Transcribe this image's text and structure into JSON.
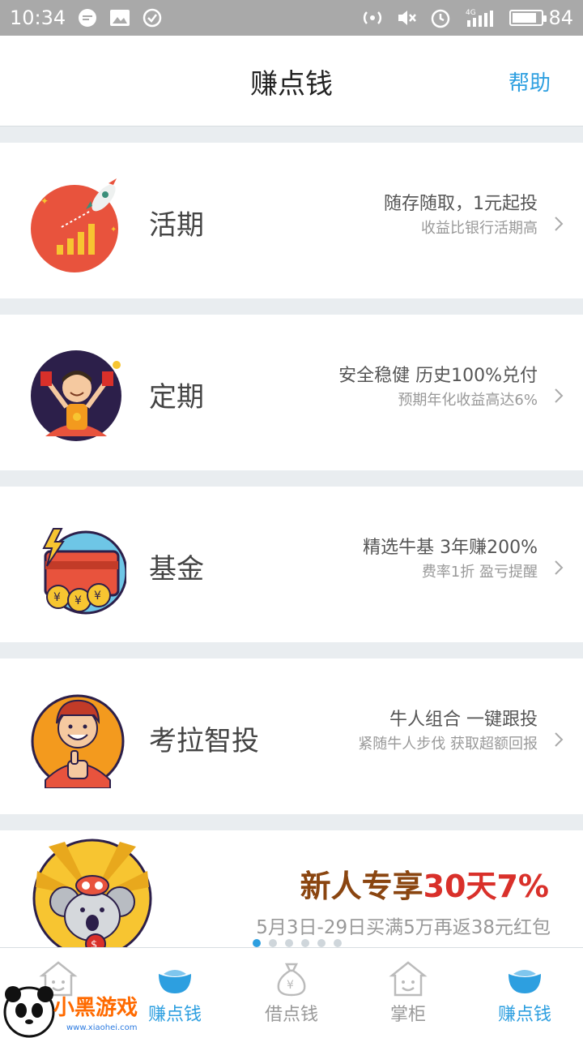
{
  "status_bar": {
    "time": "10:34",
    "battery": "84",
    "battery_level": 0.84,
    "network": "4G",
    "icons": [
      "chat-bubble-icon",
      "image-icon",
      "check-circle-icon",
      "hotspot-icon",
      "mute-icon",
      "alarm-icon",
      "signal-icon",
      "battery-icon"
    ]
  },
  "header": {
    "title": "赚点钱",
    "help": "帮助"
  },
  "products": [
    {
      "name": "活期",
      "main": "随存随取，1元起投",
      "sub": "收益比银行活期高",
      "icon": "rocket-chart-icon"
    },
    {
      "name": "定期",
      "main": "安全稳健 历史100%兑付",
      "sub": "预期年化收益高达6%",
      "icon": "happy-man-icon"
    },
    {
      "name": "基金",
      "main": "精选牛基 3年赚200%",
      "sub": "费率1折 盈亏提醒",
      "icon": "card-coins-icon"
    },
    {
      "name": "考拉智投",
      "main": "牛人组合 一键跟投",
      "sub": "紧随牛人步伐 获取超额回报",
      "icon": "thumbs-up-man-icon"
    }
  ],
  "promo": {
    "prefix": "新人专享",
    "highlight": "30天7%",
    "subtitle": "5月3日-29日买满5万再返38元红包",
    "dots": 6,
    "active_dot": 0
  },
  "tabs": [
    {
      "label": "",
      "icon": "smile-house-icon",
      "active": false
    },
    {
      "label": "赚点钱",
      "icon": "ingot-icon",
      "active": true
    },
    {
      "label": "借点钱",
      "icon": "money-bag-icon",
      "active": false
    },
    {
      "label": "掌柜",
      "icon": "smile-house-icon",
      "active": false
    },
    {
      "label": "赚点钱",
      "icon": "ingot-icon",
      "active": true
    }
  ],
  "watermark": {
    "text": "小黑游戏",
    "url": "www.xiaohei.com"
  },
  "colors": {
    "accent": "#2d9fe0",
    "promo_highlight": "#d9302a",
    "promo_text": "#8a4510"
  }
}
